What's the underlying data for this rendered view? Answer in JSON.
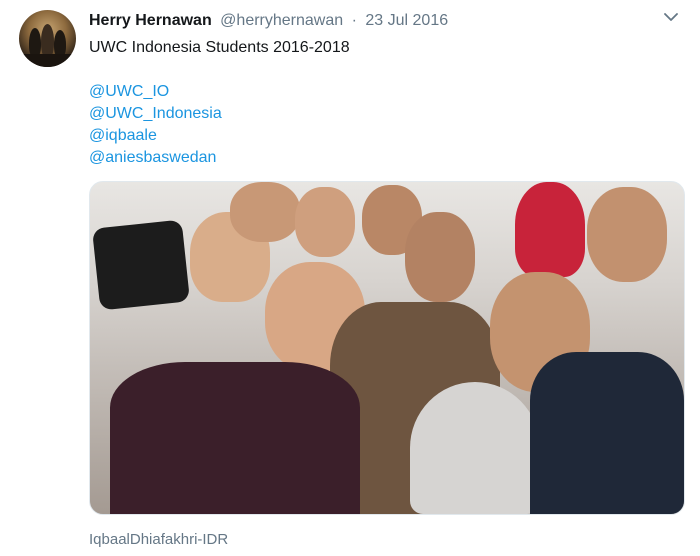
{
  "tweet": {
    "author_name": "Herry Hernawan",
    "author_handle": "@herryhernawan",
    "separator": "·",
    "date": "23 Jul 2016",
    "text": "UWC Indonesia Students 2016-2018",
    "mentions": [
      "@UWC_IO",
      "@UWC_Indonesia",
      "@iqbaale",
      "@aniesbaswedan"
    ],
    "media_caption": "IqbaalDhiafakhri-IDR"
  },
  "icons": {
    "menu": "chevron-down-icon"
  },
  "colors": {
    "link": "#1b95e0",
    "secondary_text": "#657786",
    "primary_text": "#14171a"
  }
}
